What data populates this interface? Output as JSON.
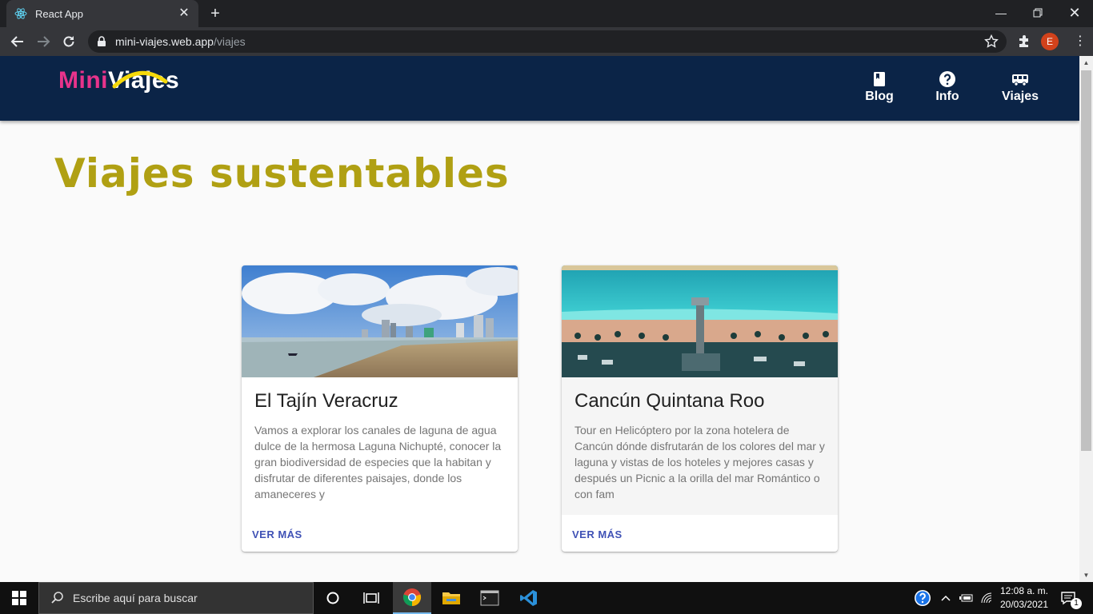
{
  "browser": {
    "tab_title": "React App",
    "url_host": "mini-viajes.web.app",
    "url_path": "/viajes",
    "profile_initial": "E"
  },
  "site": {
    "logo_part1": "Mini",
    "logo_part2": "Viajes",
    "nav": [
      {
        "label": "Blog",
        "icon": "book-icon"
      },
      {
        "label": "Info",
        "icon": "help-circle-icon"
      },
      {
        "label": "Viajes",
        "icon": "bus-icon"
      }
    ],
    "heading": "Viajes sustentables"
  },
  "cards": [
    {
      "title": "El Tajín Veracruz",
      "description": "Vamos a explorar los canales de laguna de agua dulce de la hermosa Laguna Nichupté, conocer la gran biodiversidad de especies que la habitan y disfrutar de diferentes paisajes, donde los amaneceres y",
      "action": "VER MÁS",
      "image": "beach-city-skyline-photo"
    },
    {
      "title": "Cancún Quintana Roo",
      "description": "Tour en Helicóptero por la zona hotelera de Cancún dónde disfrutarán de los colores del mar y laguna y vistas de los hoteles y mejores casas y después un Picnic a la orilla del mar Romántico o con fam",
      "action": "VER MÁS",
      "image": "aerial-beach-pier-photo"
    }
  ],
  "taskbar": {
    "search_placeholder": "Escribe aquí para buscar",
    "time": "12:08 a. m.",
    "date": "20/03/2021",
    "notifications": "1"
  },
  "colors": {
    "appbar": "#0b2447",
    "heading": "#b0a013",
    "logo_pink": "#e8338b",
    "action": "#3f51b5"
  }
}
